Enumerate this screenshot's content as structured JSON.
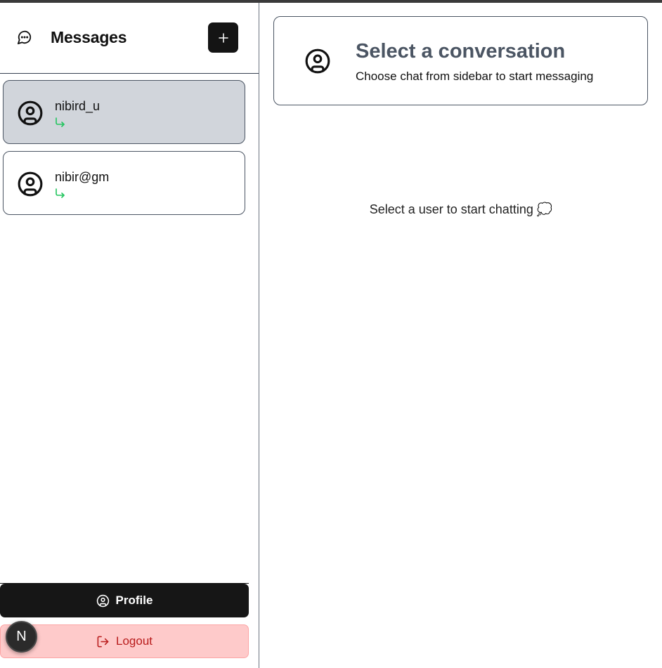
{
  "sidebar": {
    "title": "Messages",
    "new_button_icon": "plus-icon",
    "conversations": [
      {
        "name": "nibird_u",
        "active": true,
        "preview_icon": "reply-arrow-icon"
      },
      {
        "name": "nibir@gm",
        "active": false,
        "preview_icon": "reply-arrow-icon"
      }
    ],
    "profile_label": "Profile",
    "logout_label": "Logout",
    "dev_badge_label": "N"
  },
  "main": {
    "header_title": "Select a conversation",
    "header_subtitle": "Choose chat from sidebar to start messaging",
    "placeholder_text": "Select a user to start chatting 💭"
  },
  "colors": {
    "accent_dark": "#141414",
    "active_conversation": "#d1d5db",
    "logout_bg": "#fecaca",
    "logout_text": "#b91c1c",
    "preview_arrow": "#22c55e",
    "header_title": "#4b5563"
  }
}
